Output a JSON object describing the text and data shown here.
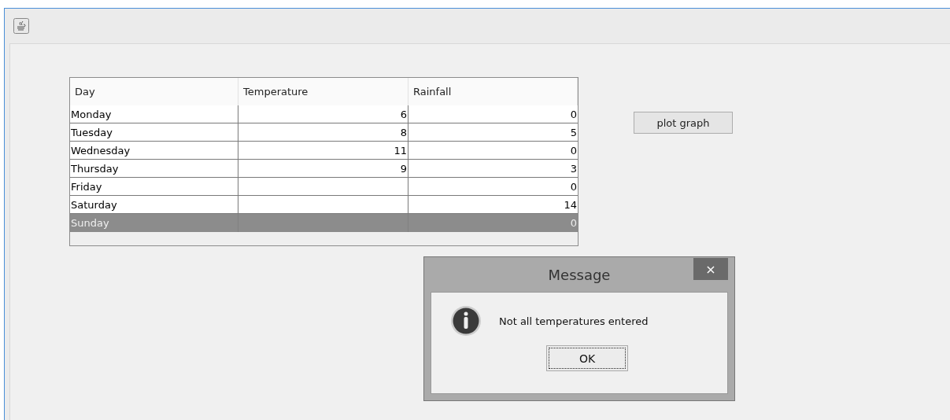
{
  "table": {
    "columns": [
      "Day",
      "Temperature",
      "Rainfall"
    ],
    "rows": [
      {
        "cells": [
          "Monday",
          "6",
          "0"
        ],
        "selected": false
      },
      {
        "cells": [
          "Tuesday",
          "8",
          "5"
        ],
        "selected": false
      },
      {
        "cells": [
          "Wednesday",
          "11",
          "0"
        ],
        "selected": false
      },
      {
        "cells": [
          "Thursday",
          "9",
          "3"
        ],
        "selected": false
      },
      {
        "cells": [
          "Friday",
          "",
          "0"
        ],
        "selected": false
      },
      {
        "cells": [
          "Saturday",
          "",
          "14"
        ],
        "selected": false
      },
      {
        "cells": [
          "Sunday",
          "",
          "0"
        ],
        "selected": true
      }
    ]
  },
  "plot_button": "plot graph",
  "dialog": {
    "title": "Message",
    "close": "×",
    "message": "Not all temperatures entered",
    "button": "OK"
  }
}
